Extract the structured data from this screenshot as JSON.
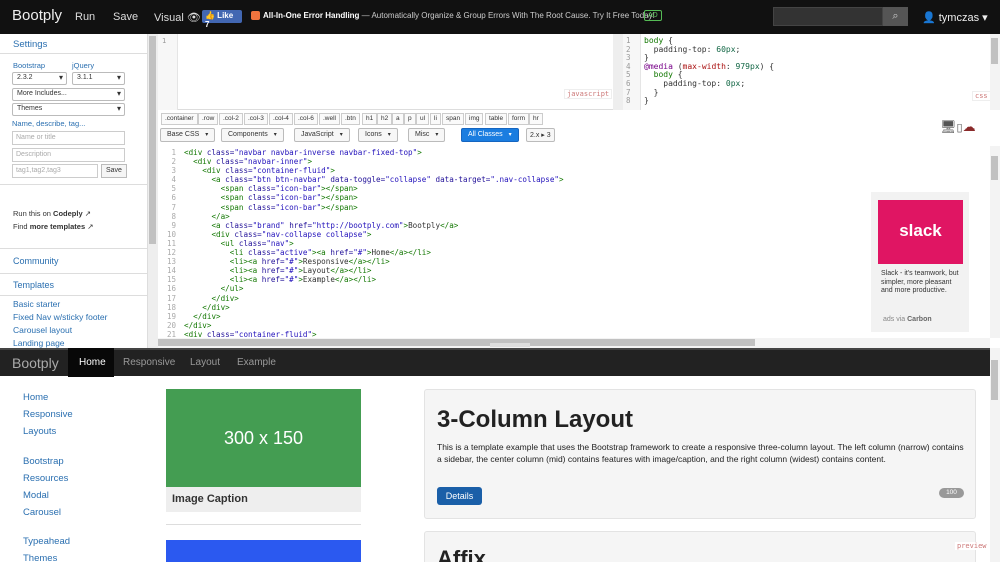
{
  "topbar": {
    "brand": "Bootply",
    "run": "Run",
    "save": "Save",
    "visual": "Visual 👁",
    "like": "👍 Like 7",
    "ad_title": "All-In-One Error Handling",
    "ad_text": " — Automatically Organize & Group Errors With The Root Cause. Try It Free Today!",
    "ad_badge": "AD",
    "search_icon": "search-icon",
    "user": "👤 tymczas ▾"
  },
  "sidebar": {
    "settings": "Settings",
    "bootstrap_label": "Bootstrap",
    "jquery_label": "jQuery",
    "bootstrap_version": "2.3.2",
    "jquery_version": "3.1.1",
    "more_includes": "More Includes...",
    "themes": "Themes",
    "name_describe": "Name, describe, tag...",
    "name_placeholder": "Name or title",
    "desc_placeholder": "Description",
    "tags_placeholder": "tag1,tag2,tag3",
    "save": "Save",
    "run_this_on": "Run this on ",
    "codeply": "Codeply",
    "find": "Find ",
    "more_templates": "more templates",
    "community": "Community",
    "templates": "Templates",
    "template_items": [
      "Basic starter",
      "Fixed Nav w/sticky footer",
      "Carousel layout",
      "Landing page"
    ]
  },
  "editors": {
    "js_label": "javascript",
    "css_label": "css",
    "html_line_numbers": [
      "1",
      "2",
      "3",
      "4",
      "5",
      "6",
      "7",
      "8",
      "9",
      "10",
      "11",
      "12",
      "13",
      "14",
      "15",
      "16",
      "17",
      "18",
      "19",
      "20",
      "21"
    ]
  },
  "toolbar": {
    "snippets": [
      ".container",
      ".row",
      ".col-2",
      ".col-3",
      ".col-4",
      ".col-6",
      ".well",
      ".btn",
      "h1",
      "h2",
      "a",
      "p",
      "ul",
      "li",
      "span",
      "img",
      "table",
      "form",
      "hr"
    ],
    "base_css": "Base CSS",
    "components": "Components",
    "javascript": "JavaScript",
    "icons": "Icons",
    "misc": "Misc",
    "all_classes": "All Classes",
    "version_switch": "2.x ▸ 3"
  },
  "ad": {
    "brand": "slack",
    "text": "Slack - it's teamwork, but simpler, more pleasant and more productive.",
    "via": "ads via ",
    "carbon": "Carbon"
  },
  "preview": {
    "brand": "Bootply",
    "nav": [
      "Home",
      "Responsive",
      "Layout",
      "Example"
    ],
    "side_links_1": [
      "Home",
      "Responsive",
      "Layouts"
    ],
    "side_links_2": [
      "Bootstrap",
      "Resources",
      "Modal",
      "Carousel"
    ],
    "side_links_3": [
      "Typeahead",
      "Themes"
    ],
    "image_placeholder": "300 x 150",
    "caption": "Image Caption",
    "title": "3-Column Layout",
    "text": "This is a template example that uses the Bootstrap framework to create a responsive three-column layout. The left column (narrow) contains a sidebar, the center column (mid) contains features with image/caption, and the right column (widest) contains content.",
    "details": "Details",
    "badge": "100",
    "next_title": "Affix",
    "label": "preview"
  },
  "colors": {
    "topbar": "#111111",
    "link": "#2a6fb0",
    "primary": "#1a7de0",
    "image_green": "#449d52",
    "slack": "#e01563"
  }
}
